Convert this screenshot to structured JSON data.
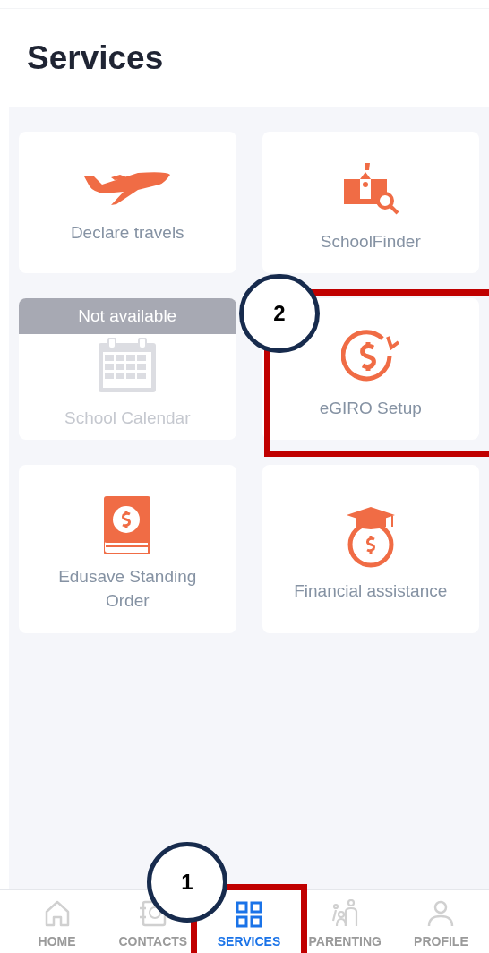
{
  "title": "Services",
  "services": [
    {
      "label": "Declare travels",
      "available": true
    },
    {
      "label": "SchoolFinder",
      "available": true
    },
    {
      "label": "School Calendar",
      "available": false,
      "badge": "Not available"
    },
    {
      "label": "eGIRO Setup",
      "available": true
    },
    {
      "label": "Edusave Standing Order",
      "available": true
    },
    {
      "label": "Financial assistance",
      "available": true
    }
  ],
  "tabs": [
    {
      "label": "HOME",
      "selected": false
    },
    {
      "label": "CONTACTS",
      "selected": false
    },
    {
      "label": "SERVICES",
      "selected": true
    },
    {
      "label": "PARENTING",
      "selected": false
    },
    {
      "label": "PROFILE",
      "selected": false
    }
  ],
  "annotations": [
    "1",
    "2"
  ]
}
